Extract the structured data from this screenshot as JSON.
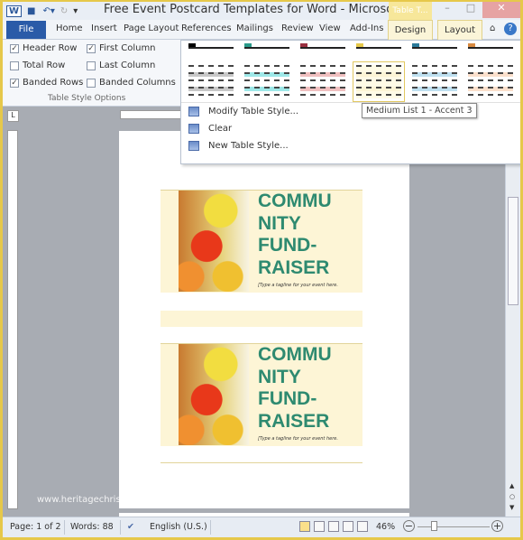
{
  "window": {
    "title": "Free Event Postcard Templates for Word  -  Microsof...",
    "context_tab": "Table T...",
    "app_icon": "W"
  },
  "tabs": [
    "File",
    "Home",
    "Insert",
    "Page Layout",
    "References",
    "Mailings",
    "Review",
    "View",
    "Add-Ins",
    "Design",
    "Layout"
  ],
  "options": {
    "group_label": "Table Style Options",
    "items": [
      {
        "label": "Header Row",
        "checked": true
      },
      {
        "label": "First Column",
        "checked": true
      },
      {
        "label": "Total Row",
        "checked": false
      },
      {
        "label": "Last Column",
        "checked": false
      },
      {
        "label": "Banded Rows",
        "checked": true
      },
      {
        "label": "Banded Columns",
        "checked": false
      }
    ]
  },
  "gallery": {
    "accents": [
      "#000000",
      "#2a9a8a",
      "#9a3040",
      "#e6c84a",
      "#2a7a9a",
      "#d88a40"
    ],
    "band_colors": [
      "#c8c8c8",
      "#9ee8e8",
      "#f0c0c0",
      "#fdf5d6",
      "#bfe0f0",
      "#fbe0cc"
    ],
    "selected_index": 3
  },
  "menu": {
    "items": [
      "Modify Table Style...",
      "Clear",
      "New Table Style..."
    ]
  },
  "tooltip": "Medium List 1 - Accent 3",
  "document": {
    "cards": [
      {
        "heading": [
          "COMMU",
          "NITY",
          "FUND-",
          "RAISER"
        ],
        "tagline": "[Type a tagline for your event here."
      },
      {
        "heading": [
          "COMMU",
          "NITY",
          "FUND-",
          "RAISER"
        ],
        "tagline": "[Type a tagline for your event here."
      }
    ]
  },
  "watermark": "www.heritagechristiancollege.com",
  "status": {
    "page": "Page: 1 of 2",
    "words": "Words: 88",
    "language": "English (U.S.)",
    "zoom": "46%",
    "zoom_level": 46
  }
}
